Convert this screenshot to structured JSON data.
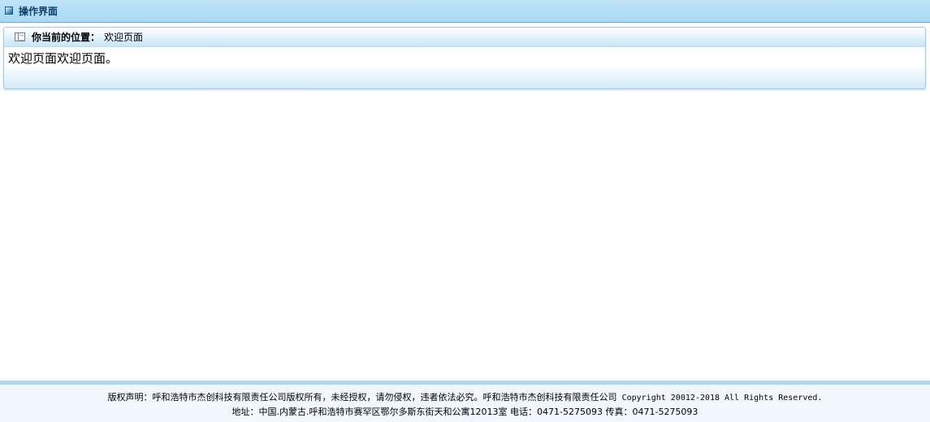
{
  "topbar": {
    "icon": "window-icon",
    "title": "操作界面"
  },
  "panel": {
    "icon": "page-icon",
    "location_label": "你当前的位置：",
    "location_value": "欢迎页面",
    "content": "欢迎页面欢迎页面。"
  },
  "footer": {
    "copyright_prefix": "版权声明：呼和浩特市杰创科技有限责任公司版权所有，未经授权，请勿侵权，违者依法必究。呼和浩特市杰创科技有限责任公司",
    "copyright_suffix": " Copyright 20012-2018 All Rights Reserved.",
    "address": "地址：中国.内蒙古.呼和浩特市赛罕区鄂尔多斯东街天和公寓12013室 电话：0471-5275093 传真：0471-5275093"
  }
}
